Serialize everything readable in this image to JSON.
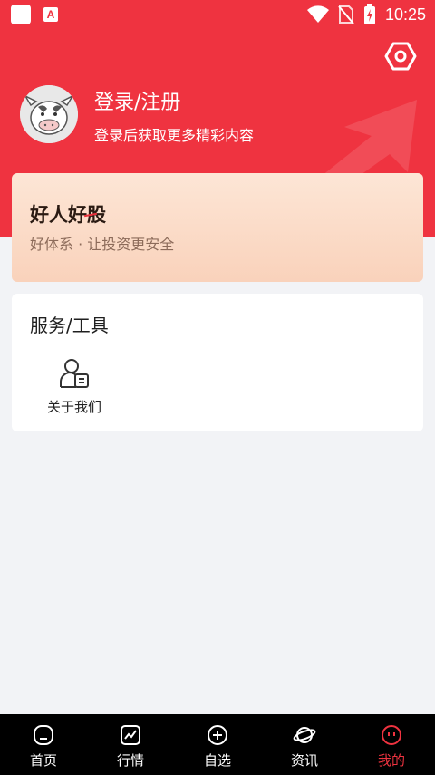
{
  "status_bar": {
    "time": "10:25",
    "icons": [
      "app-notification-icon",
      "a-notification-icon",
      "wifi-icon",
      "no-sim-icon",
      "battery-charging-icon"
    ]
  },
  "header": {
    "background_color": "#ef3340",
    "login_title": "登录/注册",
    "login_subtitle": "登录后获取更多精彩内容",
    "settings_icon": "settings-hexagon-icon",
    "avatar_icon": "cow-mascot-avatar"
  },
  "promo": {
    "title": "好人好股",
    "subtitle": "好体系 · 让投资更安全"
  },
  "services": {
    "title": "服务/工具",
    "items": [
      {
        "label": "关于我们",
        "icon": "about-us-icon"
      }
    ]
  },
  "bottom_nav": {
    "active_color": "#ef3340",
    "items": [
      {
        "label": "首页",
        "icon": "home-icon",
        "active": false
      },
      {
        "label": "行情",
        "icon": "chart-icon",
        "active": false
      },
      {
        "label": "自选",
        "icon": "add-circle-icon",
        "active": false
      },
      {
        "label": "资讯",
        "icon": "planet-icon",
        "active": false
      },
      {
        "label": "我的",
        "icon": "me-face-icon",
        "active": true
      }
    ]
  }
}
